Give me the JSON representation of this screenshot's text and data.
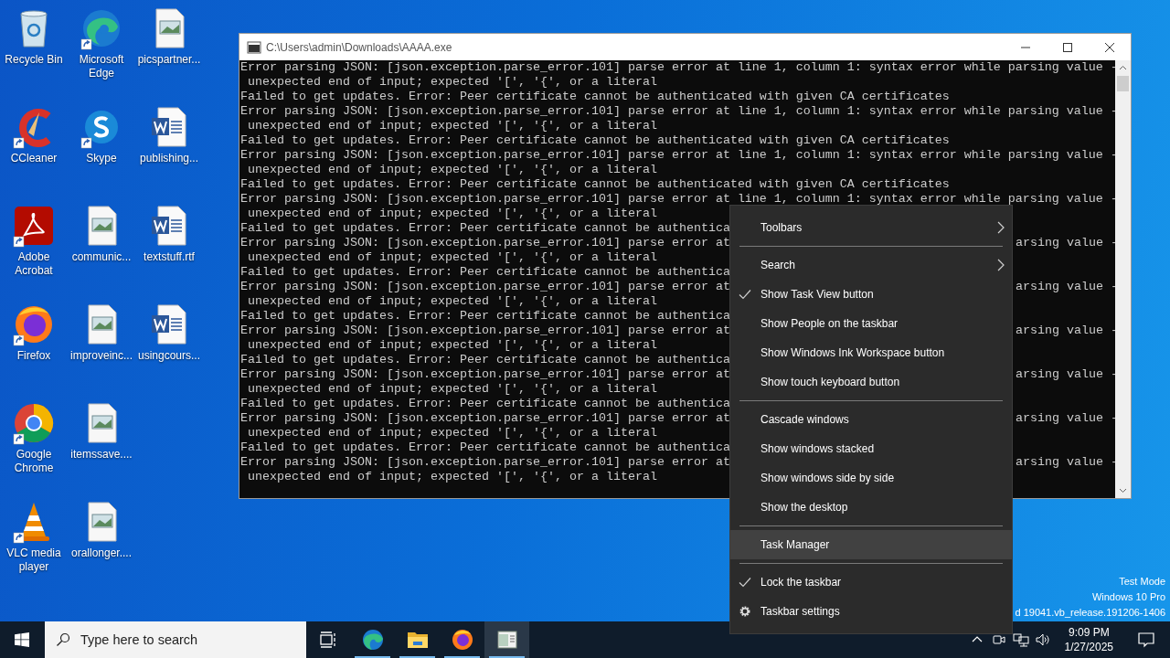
{
  "desktop_icons": [
    {
      "label": "Recycle Bin",
      "kind": "recycle",
      "shortcut": false
    },
    {
      "label": "CCleaner",
      "kind": "cleaner",
      "shortcut": true
    },
    {
      "label": "Adobe Acrobat",
      "kind": "pdf",
      "shortcut": true
    },
    {
      "label": "Firefox",
      "kind": "firefox",
      "shortcut": true
    },
    {
      "label": "Google Chrome",
      "kind": "chrome",
      "shortcut": true
    },
    {
      "label": "VLC media player",
      "kind": "vlc",
      "shortcut": true
    },
    {
      "label": "Microsoft Edge",
      "kind": "edge",
      "shortcut": true
    },
    {
      "label": "Skype",
      "kind": "skype",
      "shortcut": true
    },
    {
      "label": "communic...",
      "kind": "image",
      "shortcut": false
    },
    {
      "label": "improveinc...",
      "kind": "image",
      "shortcut": false
    },
    {
      "label": "itemssave....",
      "kind": "image",
      "shortcut": false
    },
    {
      "label": "orallonger....",
      "kind": "image",
      "shortcut": false
    },
    {
      "label": "picspartner...",
      "kind": "image",
      "shortcut": false
    },
    {
      "label": "publishing...",
      "kind": "word",
      "shortcut": false
    },
    {
      "label": "textstuff.rtf",
      "kind": "word",
      "shortcut": false
    },
    {
      "label": "usingcours...",
      "kind": "word",
      "shortcut": false
    }
  ],
  "console_window": {
    "title": "C:\\Users\\admin\\Downloads\\AAAA.exe",
    "lines": [
      {
        "text": "Error parsing JSON: [json.exception.parse_error.101] parse error at line 1, column 1: syntax error while parsing value -"
      },
      {
        "text": " unexpected end of input; expected '[', '{', or a literal"
      },
      {
        "text": "Failed to get updates. Error: Peer certificate cannot be authenticated with given CA certificates"
      },
      {
        "text": "Error parsing JSON: [json.exception.parse_error.101] parse error at line 1, column 1: syntax error while parsing value -"
      },
      {
        "text": " unexpected end of input; expected '[', '{', or a literal"
      },
      {
        "text": "Failed to get updates. Error: Peer certificate cannot be authenticated with given CA certificates"
      },
      {
        "text": "Error parsing JSON: [json.exception.parse_error.101] parse error at line 1, column 1: syntax error while parsing value -"
      },
      {
        "text": " unexpected end of input; expected '[', '{', or a literal"
      },
      {
        "text": "Failed to get updates. Error: Peer certificate cannot be authenticated with given CA certificates"
      },
      {
        "text": "Error parsing JSON: [json.exception.parse_error.101] parse error at line 1, column 1: syntax error while parsing value -"
      },
      {
        "text": " unexpected end of input; expected '[', '{', or a literal"
      },
      {
        "text": "Failed to get updates. Error: Peer certificate cannot be authentica"
      },
      {
        "text": "Error parsing JSON: [json.exception.parse_error.101] parse error at",
        "tail": "arsing value -"
      },
      {
        "text": " unexpected end of input; expected '[', '{', or a literal"
      },
      {
        "text": "Failed to get updates. Error: Peer certificate cannot be authentica"
      },
      {
        "text": "Error parsing JSON: [json.exception.parse_error.101] parse error at",
        "tail": "arsing value -"
      },
      {
        "text": " unexpected end of input; expected '[', '{', or a literal"
      },
      {
        "text": "Failed to get updates. Error: Peer certificate cannot be authentica"
      },
      {
        "text": "Error parsing JSON: [json.exception.parse_error.101] parse error at",
        "tail": "arsing value -"
      },
      {
        "text": " unexpected end of input; expected '[', '{', or a literal"
      },
      {
        "text": "Failed to get updates. Error: Peer certificate cannot be authentica"
      },
      {
        "text": "Error parsing JSON: [json.exception.parse_error.101] parse error at",
        "tail": "arsing value -"
      },
      {
        "text": " unexpected end of input; expected '[', '{', or a literal"
      },
      {
        "text": "Failed to get updates. Error: Peer certificate cannot be authentica"
      },
      {
        "text": "Error parsing JSON: [json.exception.parse_error.101] parse error at",
        "tail": "arsing value -"
      },
      {
        "text": " unexpected end of input; expected '[', '{', or a literal"
      },
      {
        "text": "Failed to get updates. Error: Peer certificate cannot be authentica"
      },
      {
        "text": "Error parsing JSON: [json.exception.parse_error.101] parse error at",
        "tail": "arsing value -"
      },
      {
        "text": " unexpected end of input; expected '[', '{', or a literal"
      }
    ]
  },
  "desktop_notice": [
    "Test Mode",
    "Windows 10 Pro",
    "d 19041.vb_release.191206-1406"
  ],
  "context_menu": {
    "groups": [
      [
        {
          "label": "Toolbars",
          "kind": "submenu",
          "selected": false
        }
      ],
      [
        {
          "label": "Search",
          "kind": "submenu",
          "selected": false
        },
        {
          "label": "Show Task View button",
          "kind": "toggle",
          "checked": true,
          "selected": false
        },
        {
          "label": "Show People on the taskbar",
          "kind": "toggle",
          "checked": false,
          "selected": false
        },
        {
          "label": "Show Windows Ink Workspace button",
          "kind": "toggle",
          "checked": false,
          "selected": false
        },
        {
          "label": "Show touch keyboard button",
          "kind": "toggle",
          "checked": false,
          "selected": false
        }
      ],
      [
        {
          "label": "Cascade windows",
          "kind": "command",
          "selected": false
        },
        {
          "label": "Show windows stacked",
          "kind": "command",
          "selected": false
        },
        {
          "label": "Show windows side by side",
          "kind": "command",
          "selected": false
        },
        {
          "label": "Show the desktop",
          "kind": "command",
          "selected": false
        }
      ],
      [
        {
          "label": "Task Manager",
          "kind": "command",
          "selected": true
        }
      ],
      [
        {
          "label": "Lock the taskbar",
          "kind": "toggle",
          "checked": true,
          "selected": false
        },
        {
          "label": "Taskbar settings",
          "kind": "settings",
          "selected": false
        }
      ]
    ]
  },
  "taskbar": {
    "search": {
      "placeholder": "Type here to search"
    },
    "apps": [
      {
        "kind": "edge",
        "running": true,
        "selected": false
      },
      {
        "kind": "explorer",
        "running": true,
        "selected": false
      },
      {
        "kind": "firefox",
        "running": true,
        "selected": false
      },
      {
        "kind": "console",
        "running": true,
        "selected": true
      }
    ],
    "clock": {
      "time": "9:09 PM",
      "date": "1/27/2025"
    }
  }
}
